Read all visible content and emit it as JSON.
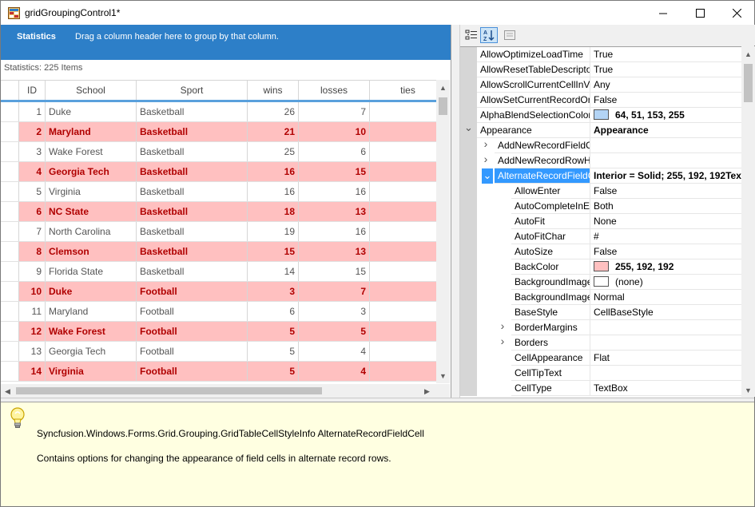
{
  "window": {
    "title": "gridGroupingControl1*",
    "icon": "app-grid-icon"
  },
  "grid": {
    "group_drop": {
      "statistics_label": "Statistics",
      "hint": "Drag a column header here to group by that column."
    },
    "statistics_text": "Statistics: 225 Items",
    "columns": [
      "ID",
      "School",
      "Sport",
      "wins",
      "losses",
      "ties"
    ],
    "rows": [
      {
        "id": "1",
        "school": "Duke",
        "sport": "Basketball",
        "wins": "26",
        "losses": "7",
        "ties": ""
      },
      {
        "id": "2",
        "school": "Maryland",
        "sport": "Basketball",
        "wins": "21",
        "losses": "10",
        "ties": ""
      },
      {
        "id": "3",
        "school": "Wake Forest",
        "sport": "Basketball",
        "wins": "25",
        "losses": "6",
        "ties": ""
      },
      {
        "id": "4",
        "school": "Georgia Tech",
        "sport": "Basketball",
        "wins": "16",
        "losses": "15",
        "ties": ""
      },
      {
        "id": "5",
        "school": "Virginia",
        "sport": "Basketball",
        "wins": "16",
        "losses": "16",
        "ties": ""
      },
      {
        "id": "6",
        "school": "NC State",
        "sport": "Basketball",
        "wins": "18",
        "losses": "13",
        "ties": ""
      },
      {
        "id": "7",
        "school": "North Carolina",
        "sport": "Basketball",
        "wins": "19",
        "losses": "16",
        "ties": ""
      },
      {
        "id": "8",
        "school": "Clemson",
        "sport": "Basketball",
        "wins": "15",
        "losses": "13",
        "ties": ""
      },
      {
        "id": "9",
        "school": "Florida State",
        "sport": "Basketball",
        "wins": "14",
        "losses": "15",
        "ties": ""
      },
      {
        "id": "10",
        "school": "Duke",
        "sport": "Football",
        "wins": "3",
        "losses": "7",
        "ties": ""
      },
      {
        "id": "11",
        "school": "Maryland",
        "sport": "Football",
        "wins": "6",
        "losses": "3",
        "ties": ""
      },
      {
        "id": "12",
        "school": "Wake Forest",
        "sport": "Football",
        "wins": "5",
        "losses": "5",
        "ties": ""
      },
      {
        "id": "13",
        "school": "Georgia Tech",
        "sport": "Football",
        "wins": "5",
        "losses": "4",
        "ties": ""
      },
      {
        "id": "14",
        "school": "Virginia",
        "sport": "Football",
        "wins": "5",
        "losses": "4",
        "ties": ""
      }
    ],
    "alternate_row_color": "#ffc0c0",
    "alternate_text_color": "#b00000",
    "header_accent": "#5aa0dc",
    "group_drop_color": "#2d7fc8"
  },
  "property_grid": {
    "toolbar": {
      "categorized_icon": "categorized-icon",
      "alphabetical_icon": "alphabetical-sort-icon",
      "property_pages_icon": "property-pages-icon"
    },
    "rows": [
      {
        "name": "AllowOptimizeLoadTime",
        "value": "True",
        "indent": 0
      },
      {
        "name": "AllowResetTableDescripto",
        "value": "True",
        "indent": 0
      },
      {
        "name": "AllowScrollCurrentCellInV",
        "value": "Any",
        "indent": 0
      },
      {
        "name": "AllowSetCurrentRecordOr",
        "value": "False",
        "indent": 0
      },
      {
        "name": "AlphaBlendSelectionColor",
        "value": "64, 51, 153, 255",
        "indent": 0,
        "swatch": "#b3d4f5",
        "bold": true
      },
      {
        "name": "Appearance",
        "value": "Appearance",
        "indent": 0,
        "expander": "down",
        "bold": true
      },
      {
        "name": "AddNewRecordFieldC",
        "value": "",
        "indent": 1,
        "expander": "right"
      },
      {
        "name": "AddNewRecordRowH",
        "value": "",
        "indent": 1,
        "expander": "right"
      },
      {
        "name": "AlternateRecordFieldC",
        "value": "Interior = Solid; 255, 192, 192Tex",
        "indent": 1,
        "expander": "down",
        "selected": true,
        "bold": true
      },
      {
        "name": "AllowEnter",
        "value": "False",
        "indent": 2
      },
      {
        "name": "AutoCompleteInE",
        "value": "Both",
        "indent": 2
      },
      {
        "name": "AutoFit",
        "value": "None",
        "indent": 2
      },
      {
        "name": "AutoFitChar",
        "value": "#",
        "indent": 2
      },
      {
        "name": "AutoSize",
        "value": "False",
        "indent": 2
      },
      {
        "name": "BackColor",
        "value": "255, 192, 192",
        "indent": 2,
        "swatch": "#ffc0c0",
        "bold": true
      },
      {
        "name": "BackgroundImage",
        "value": "(none)",
        "indent": 2,
        "swatch": "#ffffff"
      },
      {
        "name": "BackgroundImage",
        "value": "Normal",
        "indent": 2
      },
      {
        "name": "BaseStyle",
        "value": "CellBaseStyle",
        "indent": 2
      },
      {
        "name": "BorderMargins",
        "value": "",
        "indent": 2,
        "expander": "right"
      },
      {
        "name": "Borders",
        "value": "",
        "indent": 2,
        "expander": "right"
      },
      {
        "name": "CellAppearance",
        "value": "Flat",
        "indent": 2
      },
      {
        "name": "CellTipText",
        "value": "",
        "indent": 2
      },
      {
        "name": "CellType",
        "value": "TextBox",
        "indent": 2
      }
    ],
    "selection_color": "#3399ff"
  },
  "help": {
    "icon": "lightbulb-icon",
    "title": "Syncfusion.Windows.Forms.Grid.Grouping.GridTableCellStyleInfo AlternateRecordFieldCell",
    "description": "Contains options for changing the appearance of field cells in alternate record rows."
  }
}
